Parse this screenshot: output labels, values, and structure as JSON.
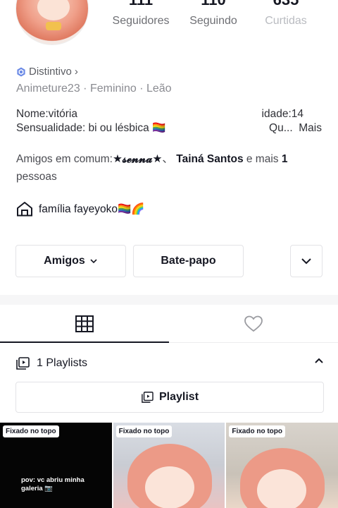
{
  "stats": [
    {
      "value": "111",
      "label": "Seguidores"
    },
    {
      "value": "110",
      "label": "Seguindo"
    },
    {
      "value": "635",
      "label": "Curtidas"
    }
  ],
  "badge": {
    "label": "Distintivo",
    "arrow": "›"
  },
  "meta": {
    "username": "Animeture23",
    "gender": "Feminino",
    "sign": "Leão",
    "sep": " · "
  },
  "bio": {
    "name": "Nome:vitória",
    "age": "idade:14",
    "orientation": "Sensualidade: bi ou lésbica 🏳️‍🌈",
    "truncated": "Qu...",
    "more": "Mais"
  },
  "mutual": {
    "prefix": "Amigos em comum:",
    "friend1": "★𝓼𝓮𝓷𝓷𝓪★",
    "sep": "、",
    "friend2": "Tainá Santos",
    "and_more": " e mais ",
    "count": "1",
    "suffix": "pessoas"
  },
  "family": {
    "label": "família fayeyoko🏳️‍🌈🌈",
    "icon": "house-icon"
  },
  "buttons": {
    "friends": "Amigos",
    "chat": "Bate-papo"
  },
  "tabs": [
    {
      "icon": "grid-icon"
    },
    {
      "icon": "heart-icon"
    }
  ],
  "playlists": {
    "count_label": "1 Playlists",
    "button_label": "Playlist"
  },
  "thumbnails": [
    {
      "pin": "Fixado no topo",
      "caption": "pov: vc abriu minha galeria 📷"
    },
    {
      "pin": "Fixado no topo",
      "caption": ""
    },
    {
      "pin": "Fixado no topo",
      "caption": ""
    }
  ],
  "colors": {
    "accent": "#161823",
    "muted": "#8a8b91",
    "border": "#e3e3e6",
    "badge_blue": "#6b8ae6"
  }
}
